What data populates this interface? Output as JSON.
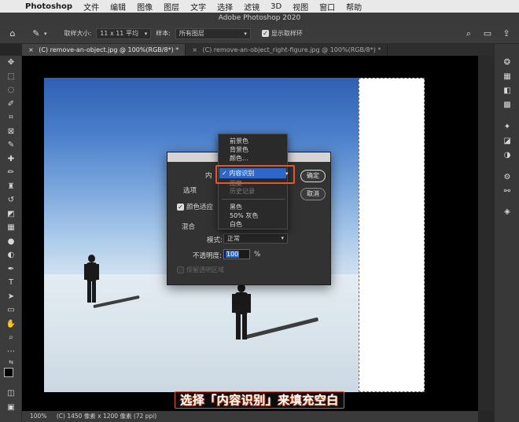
{
  "menubar": {
    "app": "Photoshop",
    "items": [
      "文件",
      "编辑",
      "图像",
      "图层",
      "文字",
      "选择",
      "滤镜",
      "3D",
      "视图",
      "窗口",
      "帮助"
    ]
  },
  "window_title": "Adobe Photoshop 2020",
  "optbar": {
    "sample_size_label": "取样大小:",
    "sample_size_value": "11 x 11 平均",
    "sample_label": "样本:",
    "sample_value": "所有图层",
    "show_ring_label": "显示取样环"
  },
  "tabs": [
    {
      "label": "(C) remove-an-object.jpg @ 100%(RGB/8*) *"
    },
    {
      "label": "(C) remove-an-object_right-figure.jpg @ 100%(RGB/8*) *"
    }
  ],
  "dialog": {
    "content_label": "内",
    "options_label": "选项",
    "color_adapt_label": "颜色适应",
    "blend_label": "混合",
    "mode_label": "模式:",
    "mode_value": "正常",
    "opacity_label": "不透明度:",
    "opacity_value": "100",
    "opacity_unit": "%",
    "preserve_label": "保留透明区域",
    "ok_label": "确定",
    "cancel_label": "取消"
  },
  "dropdown": {
    "items_top": [
      "前景色",
      "背景色",
      "颜色..."
    ],
    "selected": "内容识别",
    "items_mid": [
      "图案",
      "历史记录"
    ],
    "items_bottom": [
      "黑色",
      "50% 灰色",
      "白色"
    ]
  },
  "status": {
    "zoom": "100%",
    "info": "(C) 1450 像素 x 1200 像素 (72 ppi)"
  },
  "caption": "选择「内容识别」来填充空白",
  "colors": {
    "accent": "#2d68c9",
    "highlight_border": "#e0582e"
  }
}
